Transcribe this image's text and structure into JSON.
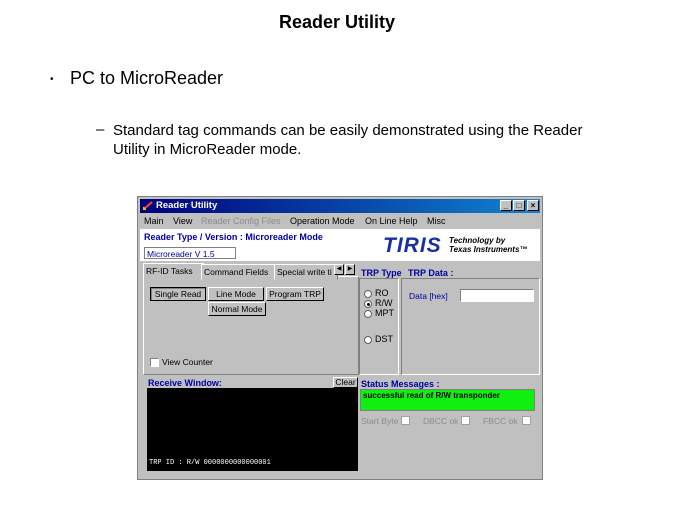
{
  "slide": {
    "title": "Reader Utility",
    "bullet_dot": "•",
    "bullet1": "PC to MicroReader",
    "dash": "–",
    "bullet2": "Standard tag commands can be easily demonstrated using the Reader Utility in MicroReader mode."
  },
  "window": {
    "title": "Reader Utility",
    "minimize_label": "_",
    "maximize_label": "□",
    "close_label": "×",
    "menu": [
      "Main",
      "View",
      "Reader Config Files",
      "Operation Mode",
      "On Line Help",
      "Misc"
    ],
    "disabled_menu_items": [
      "Reader Config Files"
    ],
    "reader_type_label": "Reader Type / Version : Microreader Mode",
    "reader_version": "Microreader V 1.5",
    "logo_text": "TIRIS",
    "logo_tagline_1": "Technology by",
    "logo_tagline_2": "Texas Instruments™"
  },
  "tabs": [
    "RF-ID Tasks",
    "Command Fields",
    "Special write ti"
  ],
  "active_tab": "RF-ID Tasks",
  "tab_scroll": {
    "left": "◀",
    "right": "▶"
  },
  "buttons": {
    "single_read": "Single Read",
    "line_mode": "Line Mode",
    "program_trp": "Program TRP",
    "normal_mode": "Normal Mode"
  },
  "view_counter_label": "View Counter",
  "trp_type": {
    "label": "TRP Type",
    "options": [
      "RO",
      "R/W",
      "MPT",
      "DST"
    ],
    "selected": "R/W"
  },
  "trp_data": {
    "label": "TRP Data :",
    "data_hex_label": "Data [hex]",
    "data_hex_value": ""
  },
  "receive_window": {
    "label": "Receive Window:",
    "clear_label": "Clear",
    "output_line": "TRP ID :  R/W 0000000000000001"
  },
  "status": {
    "label": "Status Messages :",
    "message": "successful read of R/W transponder",
    "message_color": "#10f010",
    "start_byte_label": "Start Byte",
    "dbcc_label": "DBCC ok",
    "fbcc_label": "FBCC ok"
  },
  "colors": {
    "titlebar": "#00007b",
    "accent_blue": "#0000a0",
    "window_bg": "#c0c0c0",
    "status_ok": "#10f010"
  }
}
